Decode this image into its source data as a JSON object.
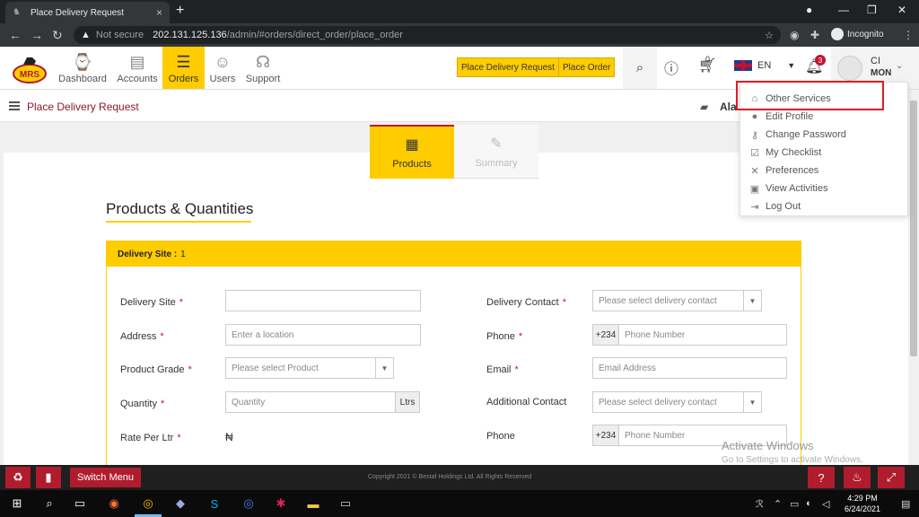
{
  "browser": {
    "tab_title": "Place Delivery Request",
    "tab_close": "×",
    "new_tab": "+",
    "not_secure": "Not secure",
    "url_host": "202.131.125.136",
    "url_path": "/admin/#orders/direct_order/place_order",
    "incognito": "Incognito"
  },
  "header": {
    "nav": [
      {
        "label": "Dashboard",
        "icon": "dashboard-icon"
      },
      {
        "label": "Accounts",
        "icon": "accounts-icon"
      },
      {
        "label": "Orders",
        "icon": "orders-icon"
      },
      {
        "label": "Users",
        "icon": "users-icon"
      },
      {
        "label": "Support",
        "icon": "support-icon"
      }
    ],
    "place_delivery_request": "Place Delivery Request",
    "place_order": "Place Order",
    "cart_count": "0",
    "language": "EN",
    "notification_count": "3",
    "user_line1": "CI",
    "user_line2": "MON"
  },
  "breadcrumb": {
    "title": "Place Delivery Request",
    "wallet_text": "Ala"
  },
  "steps": [
    {
      "label": "Products"
    },
    {
      "label": "Summary"
    }
  ],
  "section": {
    "title": "Products & Quantities",
    "panel_label": "Delivery Site :",
    "panel_value": "1"
  },
  "form": {
    "delivery_site_label": "Delivery Site",
    "address_label": "Address",
    "address_placeholder": "Enter a location",
    "product_grade_label": "Product Grade",
    "product_grade_placeholder": "Please select Product",
    "quantity_label": "Quantity",
    "quantity_placeholder": "Quantity",
    "quantity_unit": "Ltrs",
    "rate_label": "Rate Per Ltr",
    "rate_value": "₦",
    "delivery_contact_label": "Delivery Contact",
    "delivery_contact_placeholder": "Please select delivery contact",
    "phone_label": "Phone",
    "phone_prefix": "+234",
    "phone_placeholder": "Phone Number",
    "email_label": "Email",
    "email_placeholder": "Email Address",
    "additional_contact_label": "Additional Contact",
    "additional_contact_placeholder": "Please select delivery contact",
    "phone2_label": "Phone",
    "phone2_prefix": "+234",
    "phone2_placeholder": "Phone Number",
    "required_mark": "*"
  },
  "user_menu": {
    "items": [
      {
        "label": "Other Services",
        "icon": "bank-icon"
      },
      {
        "label": "Edit Profile",
        "icon": "person-icon"
      },
      {
        "label": "Change Password",
        "icon": "key-icon"
      },
      {
        "label": "My Checklist",
        "icon": "checklist-icon"
      },
      {
        "label": "Preferences",
        "icon": "tools-icon"
      },
      {
        "label": "View Activities",
        "icon": "activities-icon"
      },
      {
        "label": "Log Out",
        "icon": "logout-icon"
      }
    ]
  },
  "footer": {
    "switch_menu": "Switch Menu",
    "copyright": "Copyright 2021 © Bestaf Holdings Ltd. All Rights Reserved"
  },
  "watermark": {
    "line1": "Activate Windows",
    "line2": "Go to Settings to activate Windows."
  },
  "taskbar": {
    "time": "4:29 PM",
    "date": "6/24/2021"
  },
  "colors": {
    "accent": "#ffcc00",
    "brand_red": "#b01c2e",
    "highlight_box": "#e01b24"
  }
}
